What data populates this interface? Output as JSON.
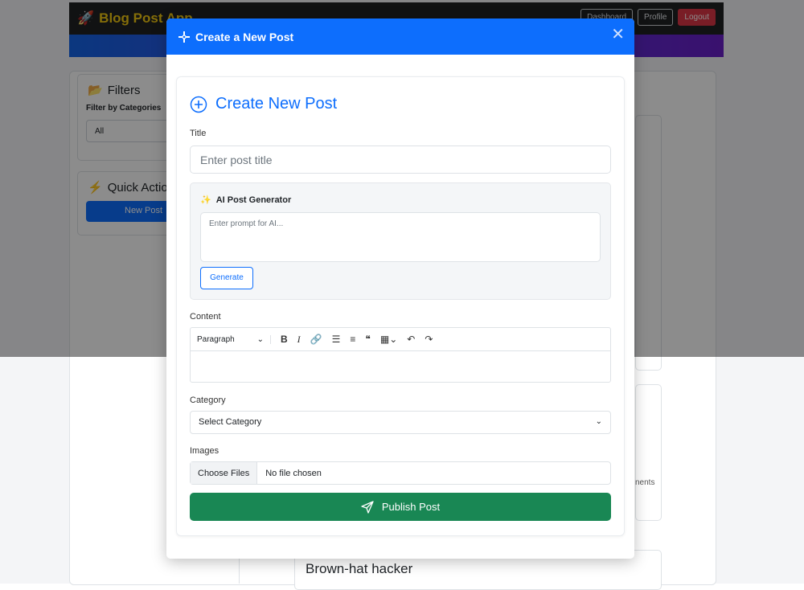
{
  "navbar": {
    "brand": "Blog Post App",
    "dashboard_label": "Dashboard",
    "profile_label": "Profile",
    "logout_label": "Logout"
  },
  "sidebar": {
    "filters_title": "Filters",
    "filter_by_label": "Filter by Categories",
    "filter_value": "All",
    "quick_actions_title": "Quick Actions",
    "new_post_label": "New Post"
  },
  "background": {
    "side_text": "nents",
    "post_title": "Brown-hat hacker"
  },
  "modal": {
    "title": "Create a New Post",
    "heading": "Create New Post",
    "title_label": "Title",
    "title_placeholder": "Enter post title",
    "ai": {
      "title": "AI Post Generator",
      "prompt_placeholder": "Enter prompt for AI...",
      "generate_label": "Generate"
    },
    "content_label": "Content",
    "editor": {
      "paragraph_label": "Paragraph"
    },
    "category_label": "Category",
    "category_value": "Select Category",
    "images_label": "Images",
    "choose_files_label": "Choose Files",
    "file_status": "No file chosen",
    "publish_label": "Publish Post"
  },
  "colors": {
    "primary": "#0d6efd",
    "success": "#198754",
    "danger": "#dc3545",
    "brand_yellow": "#f2c811"
  }
}
